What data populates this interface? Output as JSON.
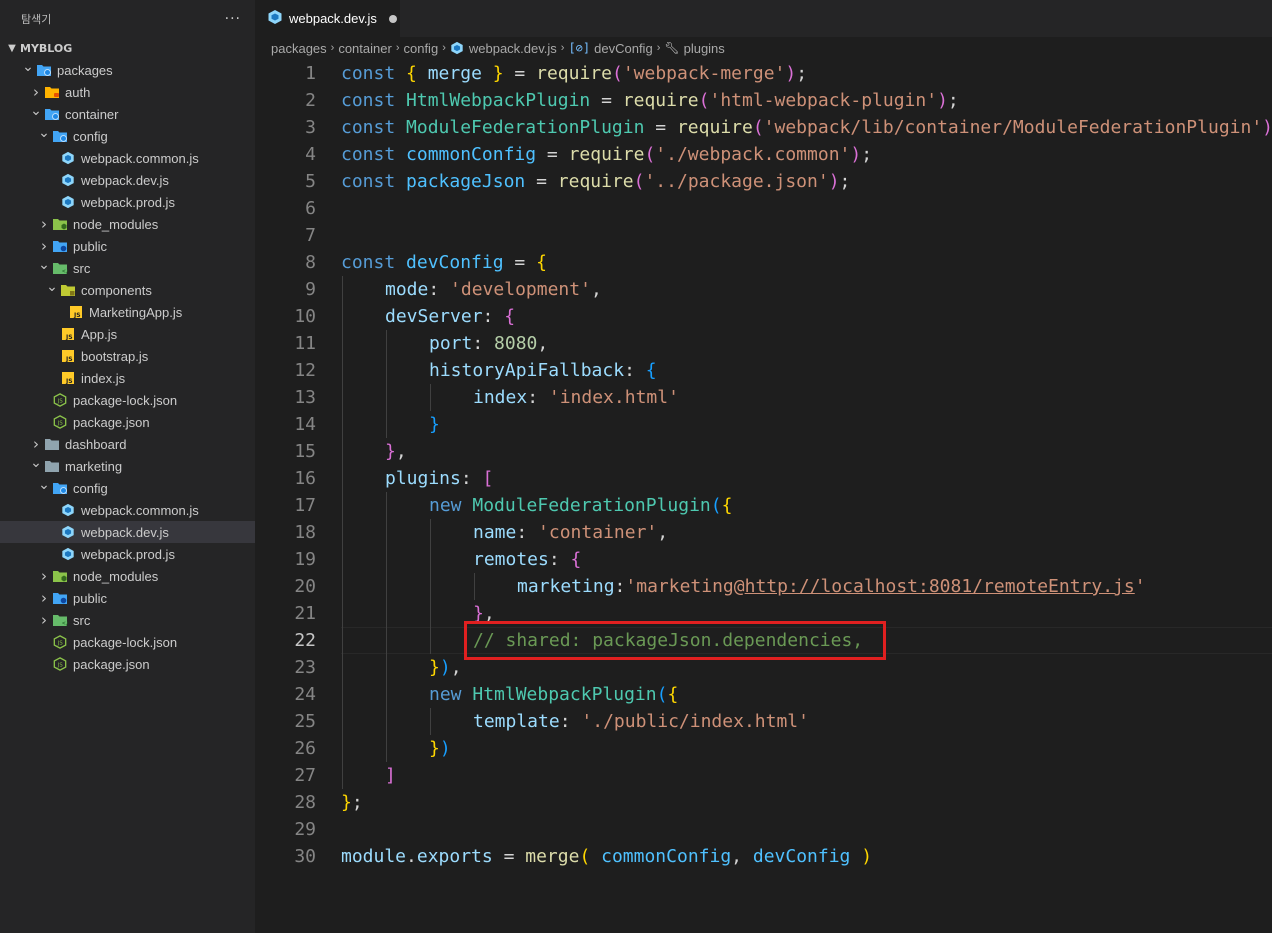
{
  "sidebar": {
    "title": "탐색기",
    "more": "···",
    "root": "MYBLOG",
    "tree": [
      {
        "label": "packages",
        "depth": 0,
        "kind": "folder-special",
        "open": true
      },
      {
        "label": "auth",
        "depth": 1,
        "kind": "folder-yellow",
        "open": false
      },
      {
        "label": "container",
        "depth": 1,
        "kind": "folder-special",
        "open": true
      },
      {
        "label": "config",
        "depth": 2,
        "kind": "folder-special",
        "open": true
      },
      {
        "label": "webpack.common.js",
        "depth": 3,
        "kind": "webpack"
      },
      {
        "label": "webpack.dev.js",
        "depth": 3,
        "kind": "webpack"
      },
      {
        "label": "webpack.prod.js",
        "depth": 3,
        "kind": "webpack"
      },
      {
        "label": "node_modules",
        "depth": 2,
        "kind": "folder-green",
        "open": false
      },
      {
        "label": "public",
        "depth": 2,
        "kind": "folder-blue",
        "open": false
      },
      {
        "label": "src",
        "depth": 2,
        "kind": "folder-src",
        "open": true
      },
      {
        "label": "components",
        "depth": 3,
        "kind": "folder-comp",
        "open": true
      },
      {
        "label": "MarketingApp.js",
        "depth": 4,
        "kind": "js"
      },
      {
        "label": "App.js",
        "depth": 3,
        "kind": "js"
      },
      {
        "label": "bootstrap.js",
        "depth": 3,
        "kind": "js"
      },
      {
        "label": "index.js",
        "depth": 3,
        "kind": "js"
      },
      {
        "label": "package-lock.json",
        "depth": 2,
        "kind": "node"
      },
      {
        "label": "package.json",
        "depth": 2,
        "kind": "node"
      },
      {
        "label": "dashboard",
        "depth": 1,
        "kind": "folder-gray",
        "open": false
      },
      {
        "label": "marketing",
        "depth": 1,
        "kind": "folder-gray",
        "open": true
      },
      {
        "label": "config",
        "depth": 2,
        "kind": "folder-special",
        "open": true
      },
      {
        "label": "webpack.common.js",
        "depth": 3,
        "kind": "webpack"
      },
      {
        "label": "webpack.dev.js",
        "depth": 3,
        "kind": "webpack",
        "selected": true
      },
      {
        "label": "webpack.prod.js",
        "depth": 3,
        "kind": "webpack"
      },
      {
        "label": "node_modules",
        "depth": 2,
        "kind": "folder-green",
        "open": false
      },
      {
        "label": "public",
        "depth": 2,
        "kind": "folder-blue",
        "open": false
      },
      {
        "label": "src",
        "depth": 2,
        "kind": "folder-src",
        "open": false
      },
      {
        "label": "package-lock.json",
        "depth": 2,
        "kind": "node"
      },
      {
        "label": "package.json",
        "depth": 2,
        "kind": "node"
      }
    ]
  },
  "tab": {
    "label": "webpack.dev.js",
    "icon": "webpack-icon",
    "dirty": true
  },
  "breadcrumb": {
    "items": [
      "packages",
      "container",
      "config",
      "webpack.dev.js",
      "devConfig",
      "plugins"
    ]
  },
  "editor": {
    "active_line": 22,
    "lines": [
      {
        "n": "1",
        "ind": 0,
        "t": [
          [
            "kw",
            "const "
          ],
          [
            "b1",
            "{ "
          ],
          [
            "var",
            "merge"
          ],
          [
            "b1",
            " }"
          ],
          [
            "pl",
            " = "
          ],
          [
            "fn",
            "require"
          ],
          [
            "b2",
            "("
          ],
          [
            "str",
            "'webpack-merge'"
          ],
          [
            "b2",
            ")"
          ],
          [
            "pl",
            ";"
          ]
        ]
      },
      {
        "n": "2",
        "ind": 0,
        "t": [
          [
            "kw",
            "const "
          ],
          [
            "cls",
            "HtmlWebpackPlugin"
          ],
          [
            "pl",
            " = "
          ],
          [
            "fn",
            "require"
          ],
          [
            "b2",
            "("
          ],
          [
            "str",
            "'html-webpack-plugin'"
          ],
          [
            "b2",
            ")"
          ],
          [
            "pl",
            ";"
          ]
        ]
      },
      {
        "n": "3",
        "ind": 0,
        "t": [
          [
            "kw",
            "const "
          ],
          [
            "cls",
            "ModuleFederationPlugin"
          ],
          [
            "pl",
            " = "
          ],
          [
            "fn",
            "require"
          ],
          [
            "b2",
            "("
          ],
          [
            "str",
            "'webpack/lib/container/ModuleFederationPlugin'"
          ],
          [
            "b2",
            ")"
          ],
          [
            "pl",
            ";"
          ]
        ]
      },
      {
        "n": "4",
        "ind": 0,
        "t": [
          [
            "kw",
            "const "
          ],
          [
            "cst",
            "commonConfig"
          ],
          [
            "pl",
            " = "
          ],
          [
            "fn",
            "require"
          ],
          [
            "b2",
            "("
          ],
          [
            "str",
            "'./webpack.common'"
          ],
          [
            "b2",
            ")"
          ],
          [
            "pl",
            ";"
          ]
        ]
      },
      {
        "n": "5",
        "ind": 0,
        "t": [
          [
            "kw",
            "const "
          ],
          [
            "cst",
            "packageJson"
          ],
          [
            "pl",
            " = "
          ],
          [
            "fn",
            "require"
          ],
          [
            "b2",
            "("
          ],
          [
            "str",
            "'../package.json'"
          ],
          [
            "b2",
            ")"
          ],
          [
            "pl",
            ";"
          ]
        ]
      },
      {
        "n": "6",
        "ind": 0,
        "t": []
      },
      {
        "n": "7",
        "ind": 0,
        "t": []
      },
      {
        "n": "8",
        "ind": 0,
        "t": [
          [
            "kw",
            "const "
          ],
          [
            "cst",
            "devConfig"
          ],
          [
            "pl",
            " = "
          ],
          [
            "b1",
            "{"
          ]
        ]
      },
      {
        "n": "9",
        "ind": 1,
        "t": [
          [
            "var",
            "mode"
          ],
          [
            "pl",
            ": "
          ],
          [
            "str",
            "'development'"
          ],
          [
            "pl",
            ","
          ]
        ]
      },
      {
        "n": "10",
        "ind": 1,
        "t": [
          [
            "var",
            "devServer"
          ],
          [
            "pl",
            ": "
          ],
          [
            "b2",
            "{"
          ]
        ]
      },
      {
        "n": "11",
        "ind": 2,
        "t": [
          [
            "var",
            "port"
          ],
          [
            "pl",
            ": "
          ],
          [
            "num",
            "8080"
          ],
          [
            "pl",
            ","
          ]
        ]
      },
      {
        "n": "12",
        "ind": 2,
        "t": [
          [
            "var",
            "historyApiFallback"
          ],
          [
            "pl",
            ": "
          ],
          [
            "b3",
            "{"
          ]
        ]
      },
      {
        "n": "13",
        "ind": 3,
        "t": [
          [
            "var",
            "index"
          ],
          [
            "pl",
            ": "
          ],
          [
            "str",
            "'index.html'"
          ]
        ]
      },
      {
        "n": "14",
        "ind": 2,
        "t": [
          [
            "b3",
            "}"
          ]
        ]
      },
      {
        "n": "15",
        "ind": 1,
        "t": [
          [
            "b2",
            "}"
          ],
          [
            "pl",
            ","
          ]
        ]
      },
      {
        "n": "16",
        "ind": 1,
        "t": [
          [
            "var",
            "plugins"
          ],
          [
            "pl",
            ": "
          ],
          [
            "b2",
            "["
          ]
        ]
      },
      {
        "n": "17",
        "ind": 2,
        "t": [
          [
            "kw",
            "new "
          ],
          [
            "cls",
            "ModuleFederationPlugin"
          ],
          [
            "b3",
            "("
          ],
          [
            "b1",
            "{"
          ]
        ]
      },
      {
        "n": "18",
        "ind": 3,
        "t": [
          [
            "var",
            "name"
          ],
          [
            "pl",
            ": "
          ],
          [
            "str",
            "'container'"
          ],
          [
            "pl",
            ","
          ]
        ]
      },
      {
        "n": "19",
        "ind": 3,
        "t": [
          [
            "var",
            "remotes"
          ],
          [
            "pl",
            ": "
          ],
          [
            "b2",
            "{"
          ]
        ]
      },
      {
        "n": "20",
        "ind": 4,
        "t": [
          [
            "var",
            "marketing"
          ],
          [
            "pl",
            ":"
          ],
          [
            "str",
            "'marketing@"
          ],
          [
            "str url",
            "http://localhost:8081/remoteEntry.js"
          ],
          [
            "str",
            "'"
          ]
        ]
      },
      {
        "n": "21",
        "ind": 3,
        "t": [
          [
            "b2",
            "}"
          ],
          [
            "pl",
            ","
          ]
        ]
      },
      {
        "n": "22",
        "ind": 3,
        "t": [
          [
            "cmt",
            "// shared: packageJson.dependencies,"
          ]
        ]
      },
      {
        "n": "23",
        "ind": 2,
        "t": [
          [
            "b1",
            "}"
          ],
          [
            "b3",
            ")"
          ],
          [
            "pl",
            ","
          ]
        ]
      },
      {
        "n": "24",
        "ind": 2,
        "t": [
          [
            "kw",
            "new "
          ],
          [
            "cls",
            "HtmlWebpackPlugin"
          ],
          [
            "b3",
            "("
          ],
          [
            "b1",
            "{"
          ]
        ]
      },
      {
        "n": "25",
        "ind": 3,
        "t": [
          [
            "var",
            "template"
          ],
          [
            "pl",
            ": "
          ],
          [
            "str",
            "'./public/index.html'"
          ]
        ]
      },
      {
        "n": "26",
        "ind": 2,
        "t": [
          [
            "b1",
            "}"
          ],
          [
            "b3",
            ")"
          ]
        ]
      },
      {
        "n": "27",
        "ind": 1,
        "t": [
          [
            "b2",
            "]"
          ]
        ]
      },
      {
        "n": "28",
        "ind": 0,
        "t": [
          [
            "b1",
            "}"
          ],
          [
            "pl",
            ";"
          ]
        ]
      },
      {
        "n": "29",
        "ind": 0,
        "t": []
      },
      {
        "n": "30",
        "ind": 0,
        "t": [
          [
            "var",
            "module"
          ],
          [
            "pl",
            "."
          ],
          [
            "var",
            "exports"
          ],
          [
            "pl",
            " = "
          ],
          [
            "fn",
            "merge"
          ],
          [
            "b1",
            "( "
          ],
          [
            "cst",
            "commonConfig"
          ],
          [
            "pl",
            ", "
          ],
          [
            "cst",
            "devConfig"
          ],
          [
            "b1",
            " )"
          ]
        ]
      }
    ]
  },
  "colors": {
    "highlight_box": "#e02020",
    "accent": "#569cd6"
  }
}
